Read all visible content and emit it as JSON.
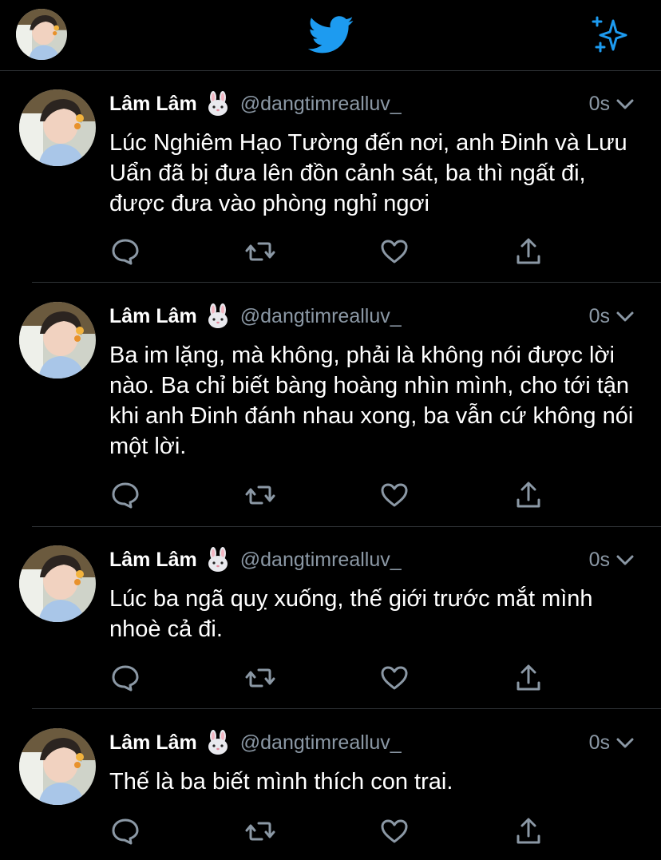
{
  "header": {
    "logo_icon": "twitter-bird-icon",
    "sparkle_icon": "sparkle-icon",
    "accent_color": "#1d9bf0"
  },
  "tweets": [
    {
      "name": "Lâm Lâm",
      "emoji_icon": "rabbit-face-emoji",
      "handle": "@dangtimrealluv_",
      "time": "0s",
      "text": "Lúc Nghiêm Hạo Tường đến nơi, anh Đinh và Lưu Uẩn đã bị đưa lên đồn cảnh sát, ba thì ngất đi, được đưa vào phòng nghỉ ngơi"
    },
    {
      "name": "Lâm Lâm",
      "emoji_icon": "rabbit-face-emoji",
      "handle": "@dangtimrealluv_",
      "time": "0s",
      "text": "Ba im lặng, mà không, phải là không nói được lời nào. Ba chỉ biết bàng hoàng nhìn mình, cho tới tận khi anh Đinh đánh nhau xong, ba vẫn cứ không nói một lời."
    },
    {
      "name": "Lâm Lâm",
      "emoji_icon": "rabbit-face-emoji",
      "handle": "@dangtimrealluv_",
      "time": "0s",
      "text": "Lúc ba ngã quỵ xuống, thế giới trước mắt mình nhoè cả đi."
    },
    {
      "name": "Lâm Lâm",
      "emoji_icon": "rabbit-face-emoji",
      "handle": "@dangtimrealluv_",
      "time": "0s",
      "text": "Thế là ba biết mình thích con trai."
    }
  ]
}
